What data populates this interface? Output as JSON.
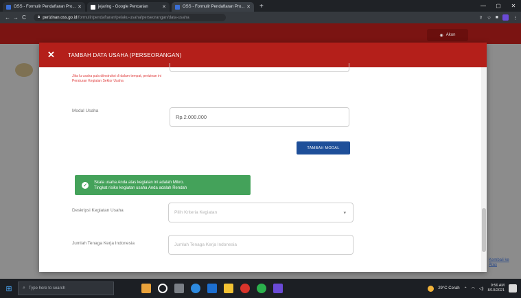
{
  "browser": {
    "tabs": [
      {
        "title": "OSS - Formulir Pendaftaran Pro...",
        "favicon_color": "#3b6fd6",
        "active": false
      },
      {
        "title": "jejaring - Google Pencarian",
        "favicon_color": "#ffffff",
        "active": false
      },
      {
        "title": "OSS - Formulir Pendaftaran Pro...",
        "favicon_color": "#3b6fd6",
        "active": true
      }
    ],
    "new_tab": "+",
    "window_controls": [
      "—",
      "▢",
      "✕"
    ],
    "nav": {
      "back": "←",
      "forward": "→",
      "reload": "C"
    },
    "address_domain": "perizinan.oss.go.id",
    "address_path": "/formulir/pendaftaran/pelaku-usaha/perseorangan/data-usaha"
  },
  "page": {
    "header_button": "Akun",
    "side_link": "Kembali ke Atas"
  },
  "modal": {
    "close_glyph": "✕",
    "title": "TAMBAH DATA USAHA (PERSEORANGAN)",
    "warning_text": "Jika lu usaha pula diinstruksi di dalam tempat, perizinan ini Peraturan Kegiatan Sektor Usaha",
    "modal_usaha_label": "Modal Usaha",
    "modal_usaha_value": "Rp.2.000.000",
    "primary_button": "TAMBAH MODAL",
    "alert_icon": "✓",
    "alert_line1": "Skala usaha Anda atas kegiatan ini adalah Mikro.",
    "alert_line2": "Tingkat risiko kegiatan usaha Anda adalah Rendah",
    "deskripsi_label": "Deskripsi Kegiatan Usaha",
    "deskripsi_placeholder": "Pilih Kriteria Kegiatan",
    "tenaga_label": "Jumlah Tenaga Kerja Indonesia",
    "tenaga_placeholder": "Jumlah Tenaga Kerja Indonesia"
  },
  "taskbar": {
    "search_placeholder": "Type here to search",
    "weather": "29°C Cerah",
    "time": "9:56 AM",
    "date": "8/10/2021",
    "app_colors": [
      "#e9a23b",
      "#ffffff",
      "#7a7f86",
      "#2d8ae0",
      "#1d6fd0",
      "#f2c233",
      "#d9342b",
      "#2bb14c",
      "#6a4ad6"
    ]
  },
  "colors": {
    "modal_header": "#b41f1a",
    "primary_button": "#1e4f99",
    "alert_success": "#44a25a"
  }
}
